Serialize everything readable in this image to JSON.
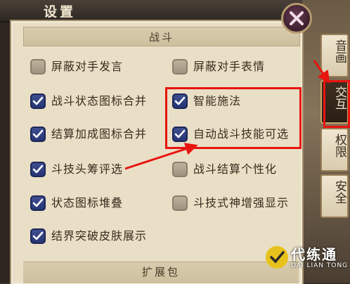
{
  "window": {
    "title": "设置"
  },
  "section": {
    "title": "战斗"
  },
  "options": [
    {
      "label": "屏蔽对手发言",
      "checked": false
    },
    {
      "label": "屏蔽对手表情",
      "checked": false
    },
    {
      "label": "战斗状态图标合并",
      "checked": true
    },
    {
      "label": "智能施法",
      "checked": true
    },
    {
      "label": "结算加成图标合并",
      "checked": true
    },
    {
      "label": "自动战斗技能可选",
      "checked": true
    },
    {
      "label": "斗技头筹评选",
      "checked": true
    },
    {
      "label": "战斗结算个性化",
      "checked": false
    },
    {
      "label": "状态图标堆叠",
      "checked": true
    },
    {
      "label": "斗技式神增强显示",
      "checked": false
    },
    {
      "label": "结界突破皮肤展示",
      "checked": true
    }
  ],
  "next_section": {
    "title": "扩展包"
  },
  "tabs": [
    {
      "label": "音画",
      "active": false
    },
    {
      "label": "交互",
      "active": true
    },
    {
      "label": "权限",
      "active": false
    },
    {
      "label": "安全",
      "active": false
    }
  ],
  "icons": {
    "close": "close-x-icon",
    "check": "checkmark-icon"
  },
  "colors": {
    "highlight": "#e8140f",
    "checkbox_on": "#2d3c7e",
    "panel": "#e9dfc6"
  },
  "watermark": {
    "name": "代练通",
    "sub": "DAI LIAN TONG"
  }
}
